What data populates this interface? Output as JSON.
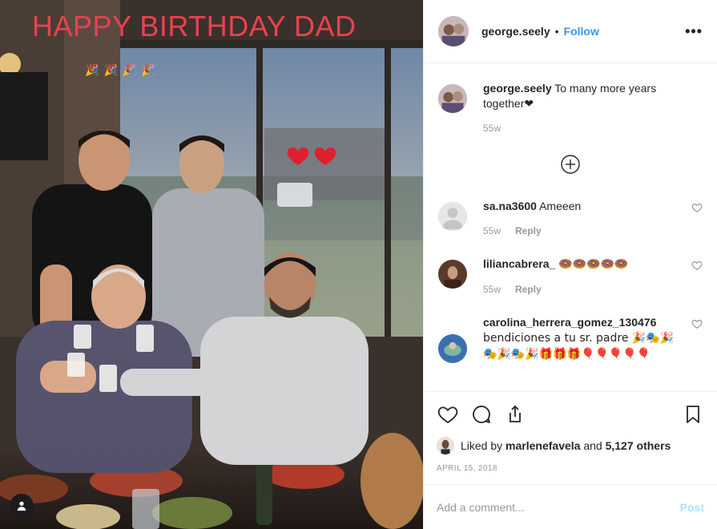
{
  "photo": {
    "caption": "HAPPY BIRTHDAY DAD",
    "party_emojis": [
      "🎉",
      "🎉",
      "🎉",
      "🎉"
    ],
    "heart_color": "#e0202d"
  },
  "header": {
    "username": "george.seely",
    "separator": "•",
    "follow_label": "Follow",
    "more_label": "•••"
  },
  "comments": [
    {
      "username": "george.seely",
      "text": "To many more years together❤",
      "age": "55w",
      "reply_label": "",
      "caption": true
    },
    {
      "username": "sa.na3600",
      "text": "Ameeen",
      "age": "55w",
      "reply_label": "Reply"
    },
    {
      "username": "liliancabrera_",
      "text": "🍩🍩🍩🍩🍩",
      "age": "55w",
      "reply_label": "Reply"
    },
    {
      "username": "carolina_herrera_gomez_130476",
      "text": "bendiciones a tu sr. padre 🎉🎭🎉🎭🎉🎭🎉🎁🎁🎁🎈🎈🎈🎈🎈",
      "age": "",
      "reply_label": ""
    }
  ],
  "likes": {
    "prefix": "Liked by",
    "user": "marlenefavela",
    "middle": "and",
    "others": "5,127 others"
  },
  "date": "APRIL 15, 2018",
  "add_comment": {
    "placeholder": "Add a comment...",
    "post_label": "Post"
  },
  "colors": {
    "accent": "#3897f0",
    "post_disabled": "#b2dffc",
    "caption_red": "#e8424f"
  },
  "icons": [
    "heart-icon",
    "comment-icon",
    "share-icon",
    "bookmark-icon",
    "plus-circle-icon",
    "user-tag-icon",
    "more-icon"
  ]
}
